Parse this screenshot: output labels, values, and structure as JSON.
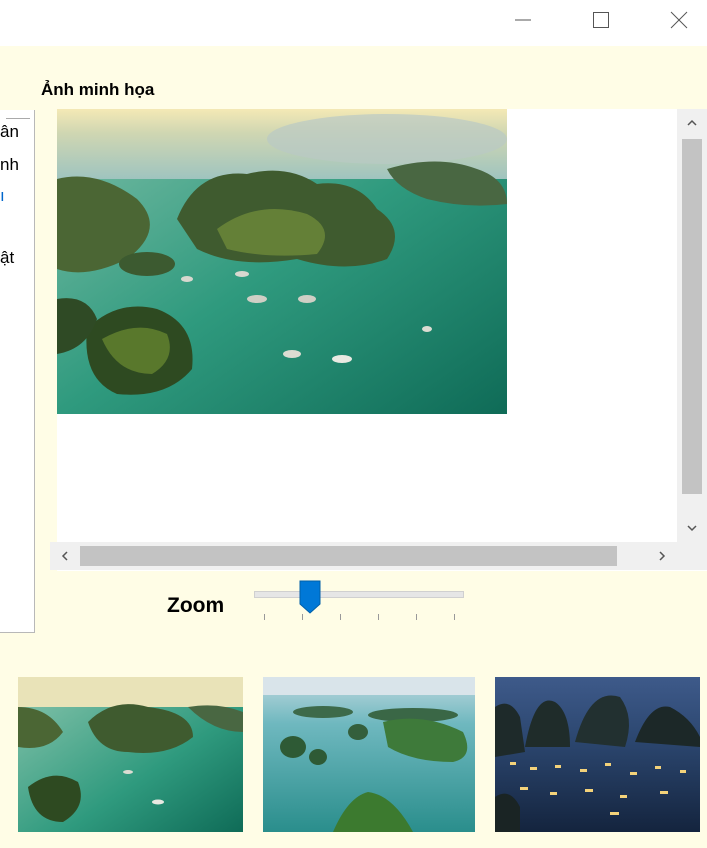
{
  "window": {
    "minimize_icon": "minimize-icon",
    "maximize_icon": "maximize-icon",
    "close_icon": "close-icon"
  },
  "section": {
    "label": "Ảnh minh họa"
  },
  "left_panel": {
    "fragments": [
      "ân",
      "nh",
      "ı",
      "ật"
    ]
  },
  "viewer": {
    "main_image": "halong-bay-aerial-sunrise"
  },
  "zoom": {
    "label": "Zoom",
    "value": 1,
    "min": 0,
    "max": 5,
    "accent": "#0078d7"
  },
  "thumbnails": [
    {
      "name": "halong-bay-aerial-sunrise"
    },
    {
      "name": "halong-bay-islands-daytime"
    },
    {
      "name": "halong-bay-boats-night"
    }
  ]
}
